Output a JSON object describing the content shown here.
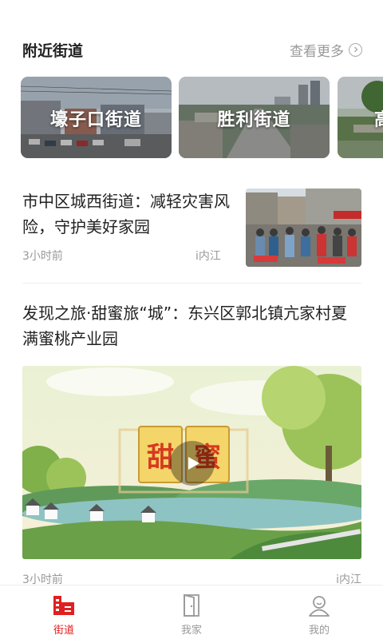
{
  "nearby": {
    "title": "附近街道",
    "more_label": "查看更多",
    "streets": [
      {
        "name": "壕子口街道"
      },
      {
        "name": "胜利街道"
      },
      {
        "name": "高"
      }
    ]
  },
  "news": [
    {
      "title": "市中区城西街道：减轻灾害风险，守护美好家园",
      "time": "3小时前",
      "source": "i内江"
    },
    {
      "title": "发现之旅·甜蜜旅“城”：东兴区郭北镇亢家村夏满蜜桃产业园",
      "video_text_1": "甜",
      "video_text_2": "蜜",
      "time": "3小时前",
      "source": "i内江"
    }
  ],
  "tabbar": {
    "items": [
      {
        "label": "街道",
        "icon": "building-icon",
        "active": true
      },
      {
        "label": "我家",
        "icon": "door-icon",
        "active": false
      },
      {
        "label": "我的",
        "icon": "user-icon",
        "active": false
      }
    ]
  },
  "colors": {
    "accent": "#e02020",
    "muted": "#999999"
  }
}
